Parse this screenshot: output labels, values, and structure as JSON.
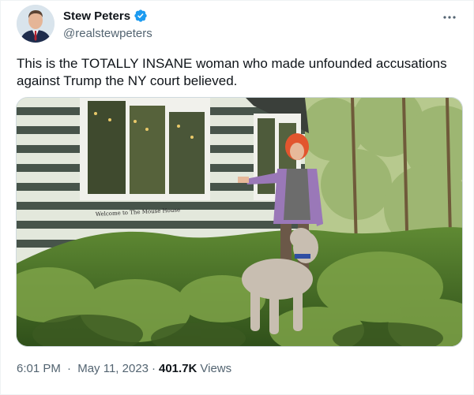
{
  "author": {
    "display_name": "Stew Peters",
    "handle": "@realstewpeters",
    "verified_icon": "verified-badge-icon",
    "verified_color": "#1d9bf0"
  },
  "more_icon": "more-horizontal-icon",
  "tweet": {
    "text": "This is the TOTALLY INSANE woman who made unfounded accusations against Trump the NY court believed."
  },
  "media": {
    "sign_text": "Welcome to The Mouse House"
  },
  "meta": {
    "time": "6:01 PM",
    "separator": "·",
    "date": "May 11, 2023",
    "views_count": "401.7K",
    "views_label": "Views"
  },
  "colors": {
    "text_primary": "#0f1419",
    "text_secondary": "#536471",
    "border": "#cfd9de"
  }
}
